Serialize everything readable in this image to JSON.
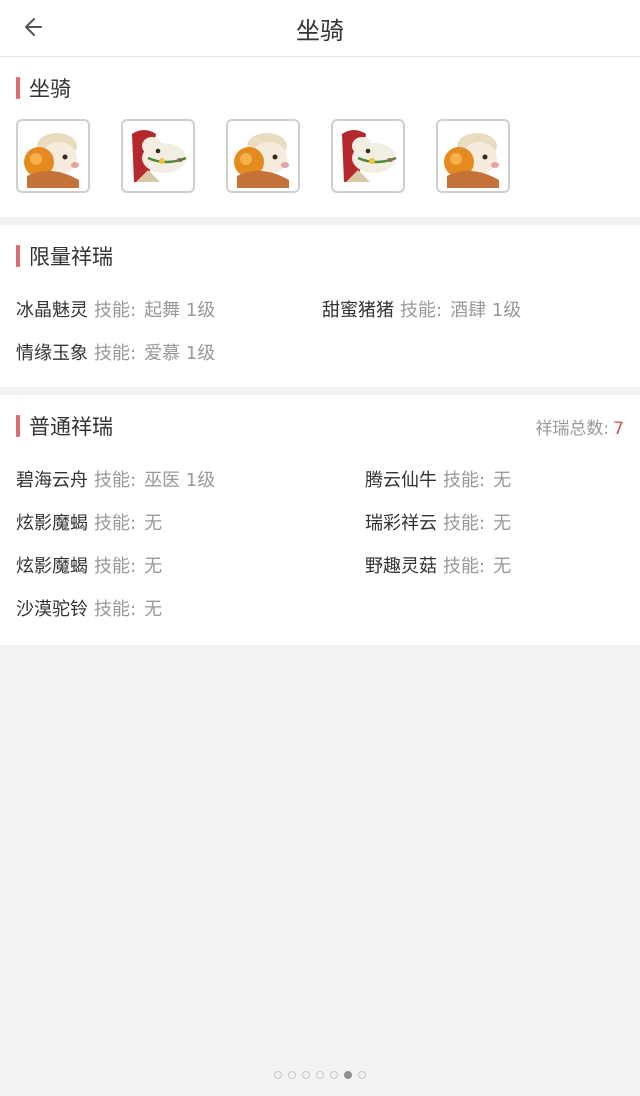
{
  "header": {
    "title": "坐骑"
  },
  "mounts_section": {
    "title": "坐骑",
    "items": [
      {
        "kind": "sheep"
      },
      {
        "kind": "horse"
      },
      {
        "kind": "sheep"
      },
      {
        "kind": "horse"
      },
      {
        "kind": "sheep"
      }
    ]
  },
  "limited": {
    "title": "限量祥瑞",
    "skill_label": "技能:",
    "items": [
      {
        "name": "冰晶魅灵",
        "skill": "起舞 1级"
      },
      {
        "name": "甜蜜猪猪",
        "skill": "酒肆 1级"
      },
      {
        "name": "情缘玉象",
        "skill": "爱慕 1级"
      }
    ]
  },
  "normal": {
    "title": "普通祥瑞",
    "total_label": "祥瑞总数:",
    "total_value": "7",
    "skill_label": "技能:",
    "items": [
      {
        "name": "碧海云舟",
        "skill": "巫医 1级"
      },
      {
        "name": "腾云仙牛",
        "skill": "无"
      },
      {
        "name": "炫影魔蝎",
        "skill": "无"
      },
      {
        "name": "瑞彩祥云",
        "skill": "无"
      },
      {
        "name": "炫影魔蝎",
        "skill": "无"
      },
      {
        "name": "野趣灵菇",
        "skill": "无"
      },
      {
        "name": "沙漠驼铃",
        "skill": "无"
      }
    ]
  },
  "pager": {
    "count": 7,
    "active_index": 5
  },
  "colors": {
    "accent": "#d9706f",
    "highlight": "#d9534f"
  }
}
